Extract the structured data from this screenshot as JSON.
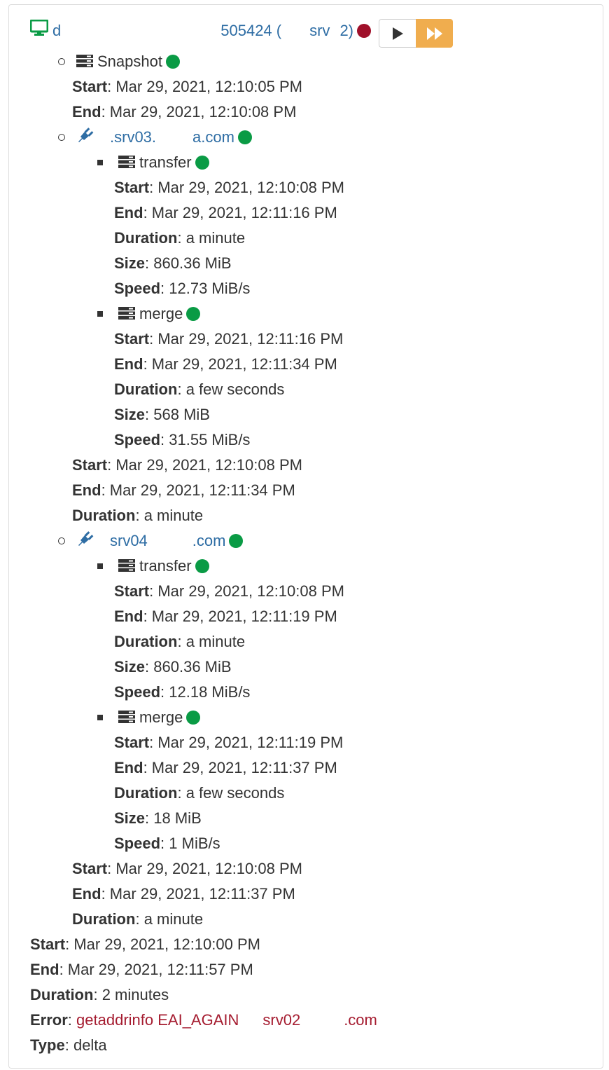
{
  "colors": {
    "success": "#0a9b45",
    "danger": "#a0102a",
    "link": "#2e6da4",
    "warning": "#f0ad4e"
  },
  "header": {
    "icon": "desktop-icon",
    "name_parts": [
      "d",
      "505424 (",
      "srv",
      "2)"
    ],
    "status": "error",
    "buttons": [
      {
        "label": "play",
        "icon": "play-icon"
      },
      {
        "label": "fast-forward",
        "icon": "fast-forward-icon"
      }
    ]
  },
  "labels": {
    "start": "Start",
    "end": "End",
    "duration": "Duration",
    "size": "Size",
    "speed": "Speed",
    "error": "Error",
    "type": "Type"
  },
  "steps": [
    {
      "kind": "task",
      "icon": "server-icon",
      "name": "Snapshot",
      "status": "success",
      "start": "Mar 29, 2021, 12:10:05 PM",
      "end": "Mar 29, 2021, 12:10:08 PM"
    },
    {
      "kind": "host",
      "icon": "plug-icon",
      "name_parts": [
        ".srv03.",
        "a.com"
      ],
      "status": "success",
      "tasks": [
        {
          "name": "transfer",
          "status": "success",
          "start": "Mar 29, 2021, 12:10:08 PM",
          "end": "Mar 29, 2021, 12:11:16 PM",
          "duration": "a minute",
          "size": "860.36 MiB",
          "speed": "12.73 MiB/s"
        },
        {
          "name": "merge",
          "status": "success",
          "start": "Mar 29, 2021, 12:11:16 PM",
          "end": "Mar 29, 2021, 12:11:34 PM",
          "duration": "a few seconds",
          "size": "568 MiB",
          "speed": "31.55 MiB/s"
        }
      ],
      "start": "Mar 29, 2021, 12:10:08 PM",
      "end": "Mar 29, 2021, 12:11:34 PM",
      "duration": "a minute"
    },
    {
      "kind": "host",
      "icon": "plug-icon",
      "name_parts": [
        "srv04",
        ".com"
      ],
      "status": "success",
      "tasks": [
        {
          "name": "transfer",
          "status": "success",
          "start": "Mar 29, 2021, 12:10:08 PM",
          "end": "Mar 29, 2021, 12:11:19 PM",
          "duration": "a minute",
          "size": "860.36 MiB",
          "speed": "12.18 MiB/s"
        },
        {
          "name": "merge",
          "status": "success",
          "start": "Mar 29, 2021, 12:11:19 PM",
          "end": "Mar 29, 2021, 12:11:37 PM",
          "duration": "a few seconds",
          "size": "18 MiB",
          "speed": "1 MiB/s"
        }
      ],
      "start": "Mar 29, 2021, 12:10:08 PM",
      "end": "Mar 29, 2021, 12:11:37 PM",
      "duration": "a minute"
    }
  ],
  "summary": {
    "start": "Mar 29, 2021, 12:10:00 PM",
    "end": "Mar 29, 2021, 12:11:57 PM",
    "duration": "2 minutes",
    "error_parts": [
      "getaddrinfo EAI_AGAIN",
      "srv02",
      ".com"
    ],
    "type": "delta"
  }
}
